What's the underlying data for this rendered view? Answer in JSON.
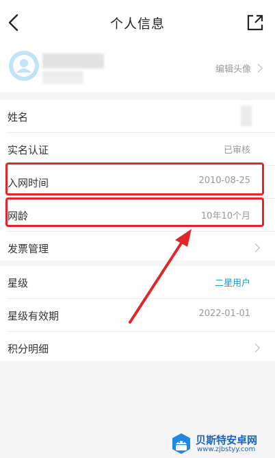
{
  "header": {
    "title": "个人信息",
    "back_icon": "chevron-left-icon",
    "share_icon": "share-external-icon"
  },
  "profile": {
    "edit_avatar_label": "编辑头像"
  },
  "account_rows": [
    {
      "label": "姓名",
      "value": ""
    },
    {
      "label": "实名认证",
      "value": "已审核"
    },
    {
      "label": "入网时间",
      "value": "2010-08-25"
    },
    {
      "label": "网龄",
      "value": "10年10个月"
    },
    {
      "label": "发票管理",
      "value": ""
    }
  ],
  "member_rows": [
    {
      "label": "星级",
      "value": "二星用户"
    },
    {
      "label": "星级有效期",
      "value": "2022-01-01"
    },
    {
      "label": "积分明细",
      "value": ""
    }
  ],
  "colors": {
    "accent": "#1a9ad6",
    "highlight": "#e0262b",
    "watermark": "#1565c0"
  },
  "watermark": {
    "title": "贝斯特安卓网",
    "url": "www.zjbstyy.com"
  }
}
